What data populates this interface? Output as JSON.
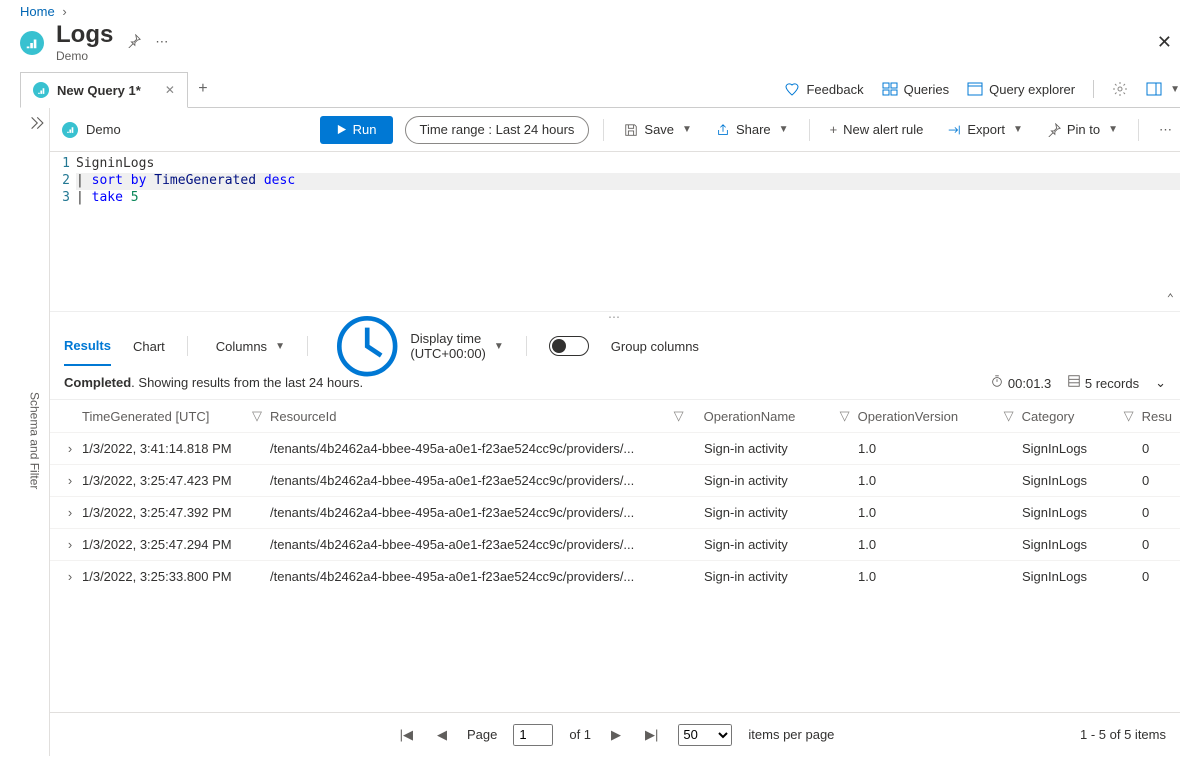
{
  "breadcrumb": {
    "home": "Home"
  },
  "header": {
    "title": "Logs",
    "subtitle": "Demo"
  },
  "tab": {
    "label": "New Query 1*"
  },
  "topRight": {
    "feedback": "Feedback",
    "queries": "Queries",
    "queryExplorer": "Query explorer"
  },
  "toolbar": {
    "scope": "Demo",
    "run": "Run",
    "timeRangeLabel": "Time range :",
    "timeRangeValue": "Last 24 hours",
    "save": "Save",
    "share": "Share",
    "newAlert": "New alert rule",
    "export": "Export",
    "pinTo": "Pin to"
  },
  "editor": {
    "lineNums": [
      "1",
      "2",
      "3"
    ],
    "l1": "SigninLogs",
    "l2_sort": "sort",
    "l2_by": "by",
    "l2_col": "TimeGenerated",
    "l2_desc": "desc",
    "l3_take": "take",
    "l3_num": "5",
    "pipe": "| "
  },
  "resultsTabs": {
    "results": "Results",
    "chart": "Chart",
    "columns": "Columns",
    "displayTime": "Display time (UTC+00:00)",
    "groupColumns": "Group columns"
  },
  "status": {
    "completed": "Completed",
    "text": ". Showing results from the last 24 hours.",
    "elapsed": "00:01.3",
    "records": "5 records"
  },
  "columns": {
    "time": "TimeGenerated [UTC]",
    "resource": "ResourceId",
    "opName": "OperationName",
    "opVersion": "OperationVersion",
    "category": "Category",
    "result": "Resu"
  },
  "rows": [
    {
      "time": "1/3/2022, 3:41:14.818 PM",
      "res": "/tenants/4b2462a4-bbee-495a-a0e1-f23ae524cc9c/providers/...",
      "op": "Sign-in activity",
      "ver": "1.0",
      "cat": "SignInLogs",
      "r": "0"
    },
    {
      "time": "1/3/2022, 3:25:47.423 PM",
      "res": "/tenants/4b2462a4-bbee-495a-a0e1-f23ae524cc9c/providers/...",
      "op": "Sign-in activity",
      "ver": "1.0",
      "cat": "SignInLogs",
      "r": "0"
    },
    {
      "time": "1/3/2022, 3:25:47.392 PM",
      "res": "/tenants/4b2462a4-bbee-495a-a0e1-f23ae524cc9c/providers/...",
      "op": "Sign-in activity",
      "ver": "1.0",
      "cat": "SignInLogs",
      "r": "0"
    },
    {
      "time": "1/3/2022, 3:25:47.294 PM",
      "res": "/tenants/4b2462a4-bbee-495a-a0e1-f23ae524cc9c/providers/...",
      "op": "Sign-in activity",
      "ver": "1.0",
      "cat": "SignInLogs",
      "r": "0"
    },
    {
      "time": "1/3/2022, 3:25:33.800 PM",
      "res": "/tenants/4b2462a4-bbee-495a-a0e1-f23ae524cc9c/providers/...",
      "op": "Sign-in activity",
      "ver": "1.0",
      "cat": "SignInLogs",
      "r": "0"
    }
  ],
  "pager": {
    "page": "Page",
    "current": "1",
    "ofTotal": "of 1",
    "perPage": "50",
    "itemsPerPage": "items per page",
    "range": "1 - 5 of 5 items"
  },
  "sideRail": {
    "label": "Schema and Filter"
  }
}
